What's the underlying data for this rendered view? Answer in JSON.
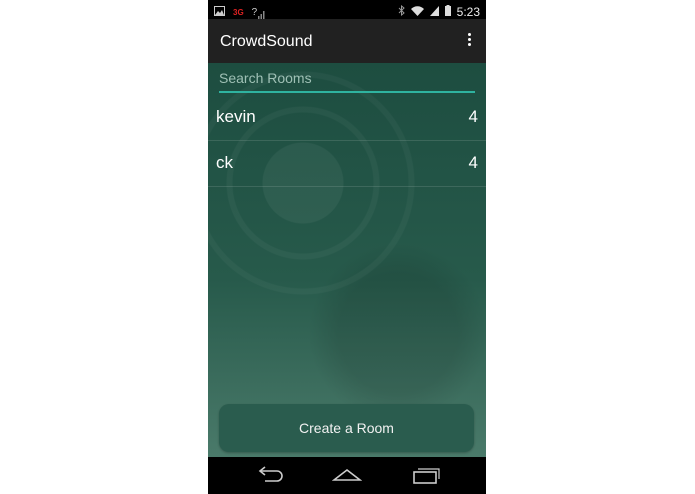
{
  "status_bar": {
    "network_badge": "3G",
    "signal_unknown": "?",
    "time": "5:23"
  },
  "action_bar": {
    "title": "CrowdSound",
    "overflow_icon": "more-vert-icon"
  },
  "search": {
    "placeholder": "Search Rooms",
    "value": ""
  },
  "rooms": [
    {
      "name": "kevin",
      "count": "4"
    },
    {
      "name": "ck",
      "count": "4"
    }
  ],
  "create_button": {
    "label": "Create a Room"
  },
  "colors": {
    "accent": "#2fb3a0",
    "background": "#1f4a3e",
    "action_bar": "#212121"
  }
}
